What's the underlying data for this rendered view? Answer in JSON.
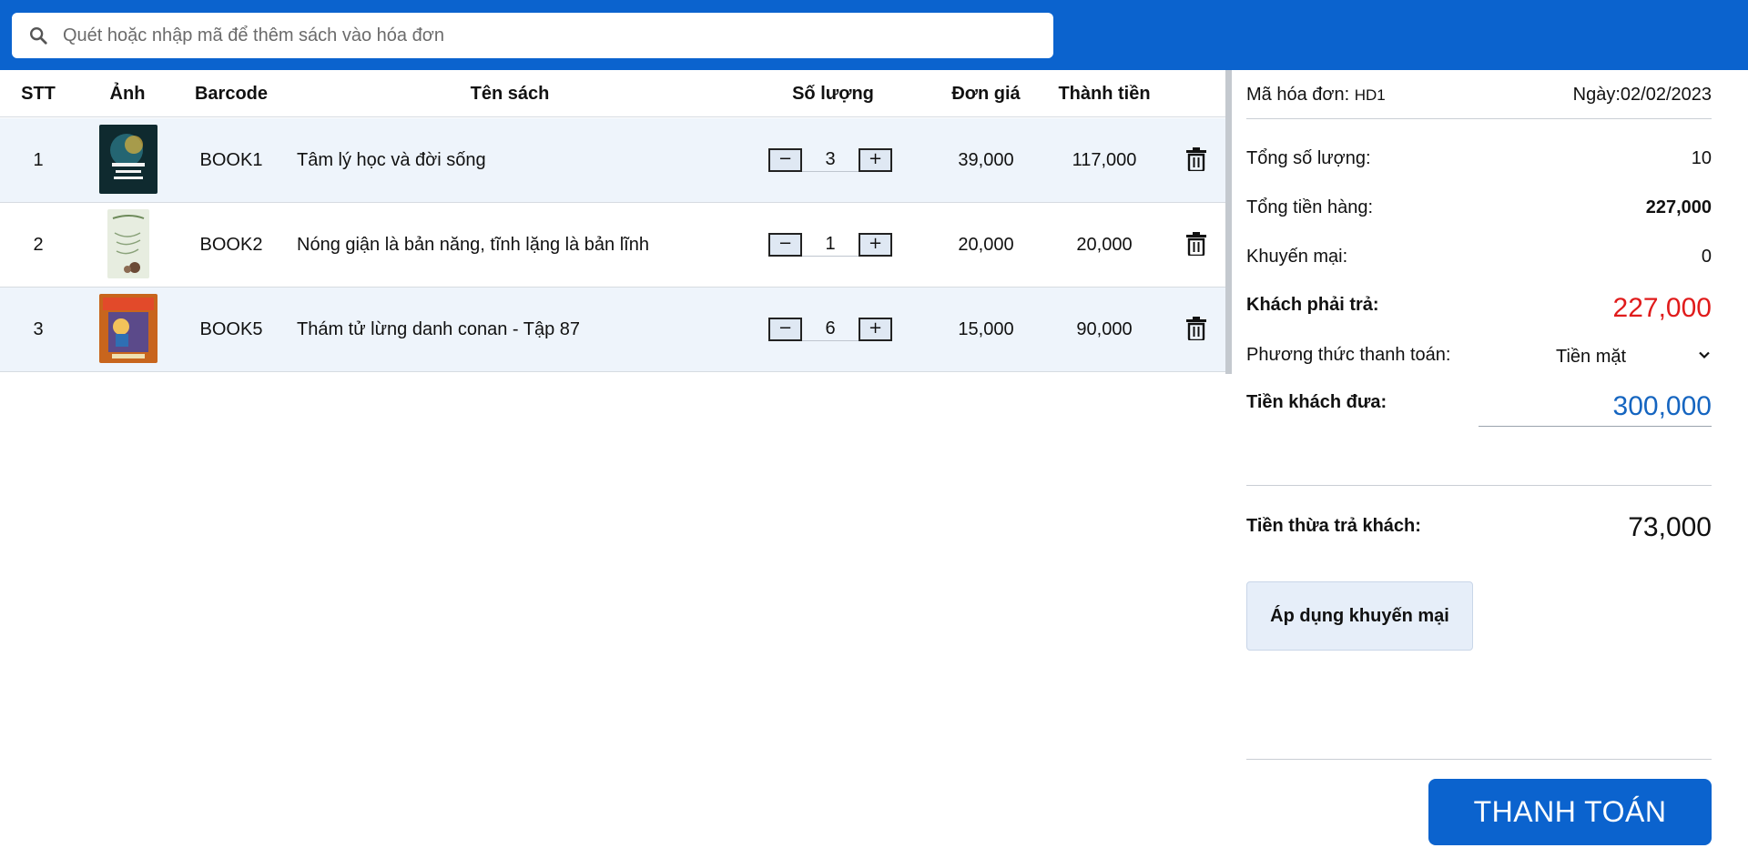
{
  "search": {
    "placeholder": "Quét hoặc nhập mã để thêm sách vào hóa đơn"
  },
  "table": {
    "headers": {
      "stt": "STT",
      "image": "Ảnh",
      "barcode": "Barcode",
      "title": "Tên sách",
      "qty": "Số lượng",
      "price": "Đơn giá",
      "total": "Thành tiền"
    },
    "rows": [
      {
        "stt": "1",
        "barcode": "BOOK1",
        "title": "Tâm lý học và đời sống",
        "qty": "3",
        "price": "39,000",
        "total": "117,000",
        "thumb_color": "#0f2a2f"
      },
      {
        "stt": "2",
        "barcode": "BOOK2",
        "title": "Nóng giận là bản năng, tĩnh lặng là bản lĩnh",
        "qty": "1",
        "price": "20,000",
        "total": "20,000",
        "thumb_color": "#e7ede0"
      },
      {
        "stt": "3",
        "barcode": "BOOK5",
        "title": "Thám tử lừng danh conan - Tập 87",
        "qty": "6",
        "price": "15,000",
        "total": "90,000",
        "thumb_color": "#c8651d"
      }
    ],
    "minus_symbol": "−",
    "plus_symbol": "+"
  },
  "invoice": {
    "code_label": "Mã hóa đơn:",
    "code_value": "HD1",
    "date_label": "Ngày:",
    "date_value": "02/02/2023",
    "total_qty_label": "Tổng số lượng:",
    "total_qty_value": "10",
    "total_goods_label": "Tổng tiền hàng:",
    "total_goods_value": "227,000",
    "discount_label": "Khuyến mại:",
    "discount_value": "0",
    "must_pay_label": "Khách phải trả:",
    "must_pay_value": "227,000",
    "payment_method_label": "Phương thức thanh toán:",
    "payment_method_value": "Tiền mặt",
    "given_label": "Tiền khách đưa:",
    "given_value": "300,000",
    "change_label": "Tiền thừa trả khách:",
    "change_value": "73,000",
    "promo_button": "Áp dụng khuyến mại",
    "pay_button": "THANH TOÁN"
  },
  "colors": {
    "primary": "#0b63ce",
    "must_pay": "#e01b1b",
    "given": "#1565c0",
    "row_alt": "#eef4fb"
  }
}
